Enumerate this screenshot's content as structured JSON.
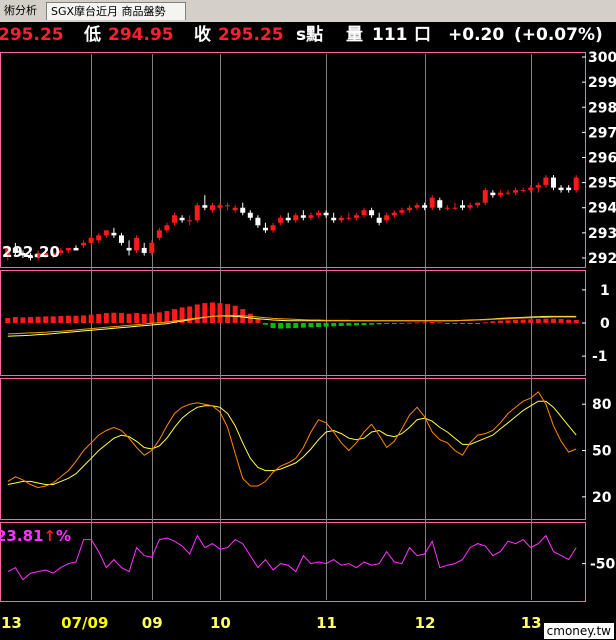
{
  "tabs": [
    "術分析",
    "SGX摩台近月 商品盤勢"
  ],
  "quote": {
    "high_value": "295.25",
    "low_label": "低",
    "low_value": "294.95",
    "close_label": "收",
    "close_value": "295.25",
    "unit": "s點",
    "volume_label": "量",
    "volume_value": "111",
    "volume_unit": "口",
    "change": "+0.20",
    "change_pct": "(+0.07%)"
  },
  "watermark": "cmoney.tw",
  "colors": {
    "up": "#ff1a1a",
    "down": "#ffffff",
    "border": "#ff66aa",
    "macd_neg": "#00c000",
    "dif": "#ffff66",
    "macd_line": "#ff9900",
    "k": "#ff8800",
    "d": "#ffff44",
    "pct": "#ff33ff",
    "grid": "#808080"
  },
  "chart_data": [
    {
      "type": "candlestick",
      "panel": "price",
      "price_label": "292.20",
      "y_ticks": [
        "300",
        "299",
        "298",
        "297",
        "296",
        "295",
        "294",
        "293",
        "292"
      ],
      "ylim": [
        291.6,
        300.2
      ],
      "x_ticks": [
        {
          "label": "13",
          "index": 0
        },
        {
          "label": "07/09",
          "index": 11
        },
        {
          "label": "09",
          "index": 19
        },
        {
          "label": "10",
          "index": 28
        },
        {
          "label": "11",
          "index": 42
        },
        {
          "label": "12",
          "index": 55
        },
        {
          "label": "13",
          "index": 69
        }
      ],
      "ohlc": [
        [
          292.1,
          292.5,
          291.9,
          292.4
        ],
        [
          292.4,
          292.6,
          292.1,
          292.2
        ],
        [
          292.2,
          292.3,
          292.0,
          292.1
        ],
        [
          292.1,
          292.2,
          291.9,
          292.0
        ],
        [
          292.0,
          292.3,
          291.9,
          292.2
        ],
        [
          292.1,
          292.3,
          292.0,
          292.2
        ],
        [
          292.1,
          292.3,
          292.0,
          292.2
        ],
        [
          292.2,
          292.4,
          292.1,
          292.3
        ],
        [
          292.3,
          292.4,
          292.2,
          292.4
        ],
        [
          292.4,
          292.5,
          292.3,
          292.3
        ],
        [
          292.5,
          292.7,
          292.4,
          292.6
        ],
        [
          292.6,
          292.9,
          292.5,
          292.8
        ],
        [
          292.7,
          293.0,
          292.6,
          292.9
        ],
        [
          292.9,
          293.1,
          292.8,
          293.1
        ],
        [
          293.0,
          293.2,
          292.8,
          292.9
        ],
        [
          292.9,
          293.0,
          292.5,
          292.6
        ],
        [
          292.4,
          292.7,
          292.1,
          292.3
        ],
        [
          292.3,
          292.9,
          292.2,
          292.8
        ],
        [
          292.4,
          292.6,
          292.1,
          292.2
        ],
        [
          292.2,
          292.7,
          292.1,
          292.6
        ],
        [
          292.8,
          293.2,
          292.7,
          293.1
        ],
        [
          293.1,
          293.4,
          293.0,
          293.3
        ],
        [
          293.4,
          293.8,
          293.3,
          293.7
        ],
        [
          293.6,
          293.7,
          293.4,
          293.5
        ],
        [
          293.5,
          293.7,
          293.3,
          293.5
        ],
        [
          293.5,
          294.2,
          293.4,
          294.1
        ],
        [
          294.1,
          294.5,
          293.9,
          294.0
        ],
        [
          293.9,
          294.2,
          293.8,
          294.1
        ],
        [
          294.0,
          294.2,
          293.9,
          294.1
        ],
        [
          294.1,
          294.2,
          293.9,
          294.1
        ],
        [
          293.9,
          294.1,
          293.8,
          294.0
        ],
        [
          294.0,
          294.2,
          293.7,
          293.8
        ],
        [
          293.8,
          293.9,
          293.5,
          293.6
        ],
        [
          293.6,
          293.7,
          293.2,
          293.3
        ],
        [
          293.2,
          293.4,
          293.0,
          293.1
        ],
        [
          293.1,
          293.4,
          293.0,
          293.3
        ],
        [
          293.4,
          293.7,
          293.3,
          293.6
        ],
        [
          293.6,
          293.8,
          293.4,
          293.5
        ],
        [
          293.5,
          293.8,
          293.4,
          293.7
        ],
        [
          293.7,
          293.9,
          293.5,
          293.6
        ],
        [
          293.6,
          293.8,
          293.5,
          293.7
        ],
        [
          293.7,
          293.9,
          293.6,
          293.8
        ],
        [
          293.8,
          293.9,
          293.6,
          293.7
        ],
        [
          293.6,
          293.8,
          293.4,
          293.5
        ],
        [
          293.5,
          293.7,
          293.4,
          293.6
        ],
        [
          293.6,
          293.8,
          293.5,
          293.6
        ],
        [
          293.6,
          293.8,
          293.5,
          293.7
        ],
        [
          293.7,
          294.0,
          293.6,
          293.9
        ],
        [
          293.9,
          294.0,
          293.6,
          293.7
        ],
        [
          293.6,
          293.8,
          293.3,
          293.4
        ],
        [
          293.5,
          293.8,
          293.4,
          293.7
        ],
        [
          293.7,
          293.9,
          293.6,
          293.8
        ],
        [
          293.8,
          294.0,
          293.7,
          293.9
        ],
        [
          293.9,
          294.1,
          293.8,
          294.0
        ],
        [
          294.0,
          294.2,
          293.9,
          294.1
        ],
        [
          294.1,
          294.2,
          293.9,
          294.0
        ],
        [
          294.0,
          294.5,
          293.9,
          294.4
        ],
        [
          294.3,
          294.4,
          293.9,
          294.0
        ],
        [
          294.0,
          294.1,
          293.9,
          294.0
        ],
        [
          294.0,
          294.2,
          293.9,
          294.0
        ],
        [
          294.1,
          294.3,
          293.9,
          294.0
        ],
        [
          294.0,
          294.2,
          293.9,
          294.1
        ],
        [
          294.1,
          294.2,
          294.0,
          294.2
        ],
        [
          294.2,
          294.8,
          294.1,
          294.7
        ],
        [
          294.6,
          294.7,
          294.4,
          294.5
        ],
        [
          294.5,
          294.7,
          294.4,
          294.6
        ],
        [
          294.6,
          294.7,
          294.5,
          294.6
        ],
        [
          294.6,
          294.8,
          294.5,
          294.7
        ],
        [
          294.7,
          294.8,
          294.6,
          294.7
        ],
        [
          294.7,
          294.9,
          294.6,
          294.8
        ],
        [
          294.8,
          295.0,
          294.6,
          294.9
        ],
        [
          294.9,
          295.3,
          294.8,
          295.2
        ],
        [
          295.2,
          295.3,
          294.7,
          294.8
        ],
        [
          294.8,
          294.9,
          294.6,
          294.7
        ],
        [
          294.8,
          294.9,
          294.6,
          294.7
        ],
        [
          294.7,
          295.3,
          294.6,
          295.2
        ]
      ]
    },
    {
      "type": "bar",
      "panel": "macd",
      "y_ticks": [
        "1",
        "0",
        "-1"
      ],
      "ylim": [
        -1.6,
        1.6
      ],
      "histogram": [
        0.15,
        0.18,
        0.17,
        0.18,
        0.19,
        0.2,
        0.2,
        0.21,
        0.22,
        0.22,
        0.23,
        0.25,
        0.27,
        0.3,
        0.31,
        0.3,
        0.28,
        0.3,
        0.27,
        0.28,
        0.32,
        0.36,
        0.42,
        0.47,
        0.5,
        0.56,
        0.6,
        0.62,
        0.6,
        0.57,
        0.52,
        0.42,
        0.28,
        0.12,
        -0.05,
        -0.15,
        -0.17,
        -0.16,
        -0.15,
        -0.14,
        -0.13,
        -0.12,
        -0.11,
        -0.1,
        -0.09,
        -0.08,
        -0.07,
        -0.06,
        -0.05,
        -0.04,
        -0.02,
        -0.01,
        0.0,
        0.01,
        0.02,
        0.02,
        0.03,
        0.02,
        -0.01,
        -0.02,
        -0.02,
        -0.02,
        -0.01,
        0.02,
        0.05,
        0.07,
        0.08,
        0.09,
        0.1,
        0.11,
        0.12,
        0.13,
        0.13,
        0.12,
        0.1,
        0.09
      ],
      "dif": [
        -0.4,
        -0.39,
        -0.38,
        -0.37,
        -0.35,
        -0.34,
        -0.32,
        -0.3,
        -0.28,
        -0.26,
        -0.24,
        -0.22,
        -0.2,
        -0.18,
        -0.16,
        -0.14,
        -0.12,
        -0.1,
        -0.08,
        -0.06,
        -0.04,
        -0.02,
        0.02,
        0.06,
        0.1,
        0.14,
        0.17,
        0.2,
        0.21,
        0.21,
        0.2,
        0.18,
        0.15,
        0.13,
        0.11,
        0.09,
        0.08,
        0.07,
        0.07,
        0.07,
        0.07,
        0.07,
        0.07,
        0.07,
        0.07,
        0.07,
        0.07,
        0.07,
        0.07,
        0.07,
        0.07,
        0.07,
        0.07,
        0.07,
        0.07,
        0.07,
        0.07,
        0.07,
        0.07,
        0.07,
        0.08,
        0.09,
        0.1,
        0.11,
        0.12,
        0.14,
        0.15,
        0.16,
        0.17,
        0.18,
        0.19,
        0.2,
        0.2,
        0.2,
        0.2,
        0.2
      ],
      "macd": [
        -0.33,
        -0.32,
        -0.31,
        -0.3,
        -0.29,
        -0.28,
        -0.26,
        -0.25,
        -0.23,
        -0.21,
        -0.19,
        -0.17,
        -0.15,
        -0.13,
        -0.11,
        -0.09,
        -0.07,
        -0.05,
        -0.03,
        -0.01,
        0.01,
        0.03,
        0.06,
        0.09,
        0.12,
        0.15,
        0.18,
        0.2,
        0.22,
        0.23,
        0.23,
        0.22,
        0.2,
        0.18,
        0.16,
        0.14,
        0.13,
        0.12,
        0.11,
        0.1,
        0.09,
        0.09,
        0.08,
        0.08,
        0.08,
        0.08,
        0.07,
        0.07,
        0.07,
        0.07,
        0.07,
        0.07,
        0.07,
        0.07,
        0.07,
        0.07,
        0.07,
        0.07,
        0.07,
        0.07,
        0.08,
        0.08,
        0.09,
        0.1,
        0.11,
        0.12,
        0.13,
        0.14,
        0.15,
        0.16,
        0.17,
        0.17,
        0.18,
        0.18,
        0.18,
        0.18
      ]
    },
    {
      "type": "line",
      "panel": "kd",
      "y_ticks": [
        "80",
        "50",
        "20"
      ],
      "ylim": [
        5,
        97
      ],
      "k": [
        30,
        33,
        31,
        28,
        26,
        27,
        29,
        33,
        37,
        43,
        50,
        55,
        60,
        63,
        65,
        63,
        58,
        52,
        47,
        50,
        57,
        66,
        74,
        78,
        80,
        81,
        80,
        79,
        75,
        65,
        48,
        32,
        27,
        27,
        30,
        36,
        40,
        42,
        45,
        52,
        62,
        70,
        68,
        62,
        55,
        50,
        55,
        62,
        67,
        60,
        52,
        56,
        64,
        73,
        78,
        72,
        62,
        57,
        55,
        50,
        47,
        55,
        60,
        61,
        63,
        68,
        74,
        78,
        82,
        84,
        88,
        80,
        66,
        56,
        49,
        51
      ],
      "d": [
        28,
        29,
        30,
        30,
        29,
        28,
        28,
        30,
        32,
        35,
        40,
        45,
        50,
        54,
        58,
        60,
        59,
        56,
        52,
        51,
        53,
        58,
        65,
        71,
        75,
        78,
        79,
        79,
        78,
        74,
        66,
        55,
        45,
        39,
        37,
        37,
        38,
        40,
        42,
        46,
        51,
        57,
        62,
        63,
        61,
        58,
        57,
        58,
        62,
        63,
        60,
        59,
        61,
        65,
        70,
        71,
        69,
        65,
        62,
        58,
        54,
        54,
        56,
        58,
        60,
        64,
        68,
        72,
        76,
        79,
        82,
        82,
        78,
        72,
        66,
        60
      ]
    },
    {
      "type": "line",
      "panel": "pct",
      "value_label": "23.81",
      "value_suffix": "%",
      "arrow": "↑",
      "y_ticks": [
        "-50"
      ],
      "ylim": [
        -98,
        2
      ],
      "values": [
        -60,
        -55,
        -70,
        -62,
        -60,
        -58,
        -62,
        -55,
        -50,
        -48,
        -20,
        -20,
        -35,
        -55,
        -45,
        -55,
        -60,
        -30,
        -40,
        -42,
        -20,
        -18,
        -22,
        -28,
        -38,
        -15,
        -30,
        -25,
        -32,
        -30,
        -20,
        -25,
        -40,
        -55,
        -45,
        -58,
        -50,
        -52,
        -60,
        -40,
        -50,
        -48,
        -50,
        -45,
        -52,
        -50,
        -55,
        -48,
        -52,
        -50,
        -35,
        -48,
        -50,
        -30,
        -40,
        -38,
        -22,
        -55,
        -52,
        -50,
        -45,
        -30,
        -25,
        -28,
        -40,
        -35,
        -22,
        -25,
        -20,
        -30,
        -25,
        -15,
        -35,
        -40,
        -45,
        -30
      ]
    }
  ]
}
